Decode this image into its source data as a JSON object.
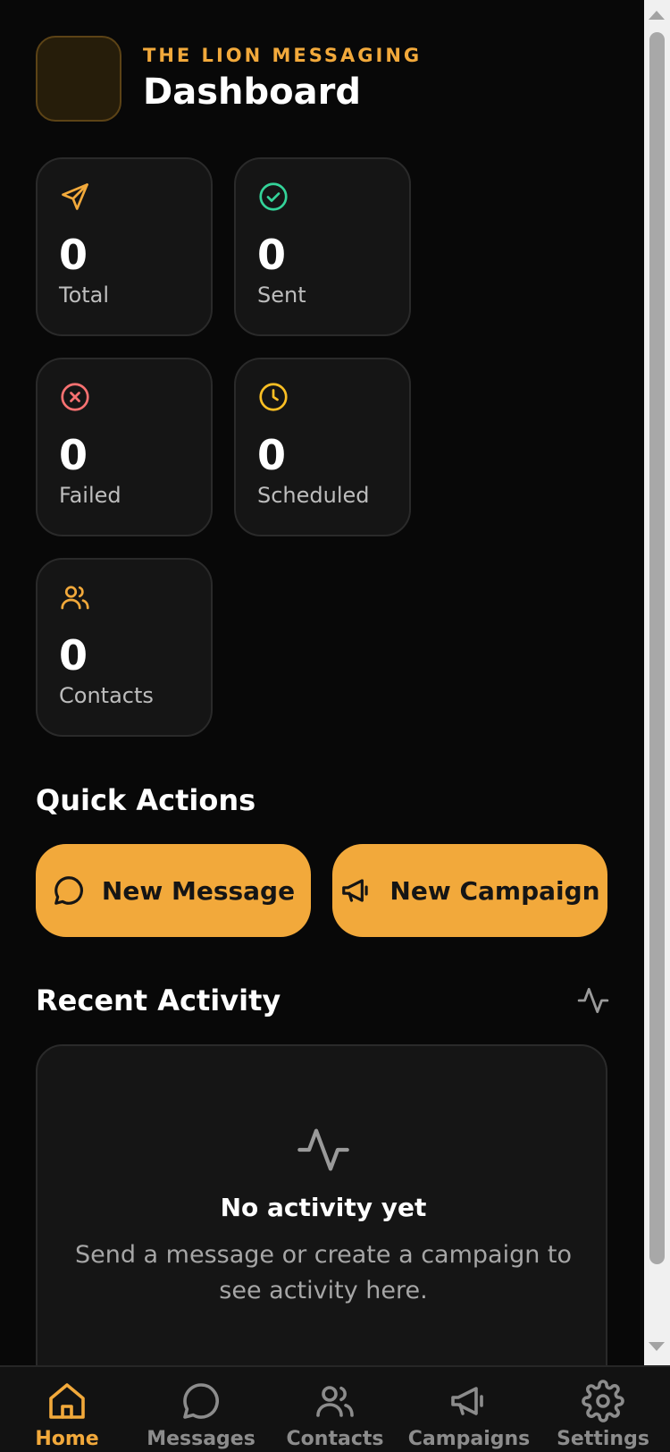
{
  "header": {
    "brand": "THE LION MESSAGING",
    "title": "Dashboard"
  },
  "stats": [
    {
      "value": "0",
      "label": "Total",
      "icon": "send-icon",
      "color": "#f2a93b"
    },
    {
      "value": "0",
      "label": "Sent",
      "icon": "check-circle-icon",
      "color": "#34d399"
    },
    {
      "value": "0",
      "label": "Failed",
      "icon": "x-circle-icon",
      "color": "#f87171"
    },
    {
      "value": "0",
      "label": "Scheduled",
      "icon": "clock-icon",
      "color": "#fbbf24"
    },
    {
      "value": "0",
      "label": "Contacts",
      "icon": "users-icon",
      "color": "#f2a93b"
    }
  ],
  "quick_actions": {
    "title": "Quick Actions",
    "new_message": "New Message",
    "new_campaign": "New Campaign"
  },
  "recent_activity": {
    "title": "Recent Activity",
    "empty_title": "No activity yet",
    "empty_desc": "Send a message or create a campaign to see activity here."
  },
  "nav": {
    "items": [
      {
        "label": "Home",
        "icon": "home-icon",
        "active": true
      },
      {
        "label": "Messages",
        "icon": "message-icon"
      },
      {
        "label": "Contacts",
        "icon": "users-icon"
      },
      {
        "label": "Campaigns",
        "icon": "megaphone-icon"
      },
      {
        "label": "Settings",
        "icon": "gear-icon"
      }
    ]
  },
  "colors": {
    "accent": "#f2a93b",
    "background": "#080808",
    "card": "#151515"
  }
}
